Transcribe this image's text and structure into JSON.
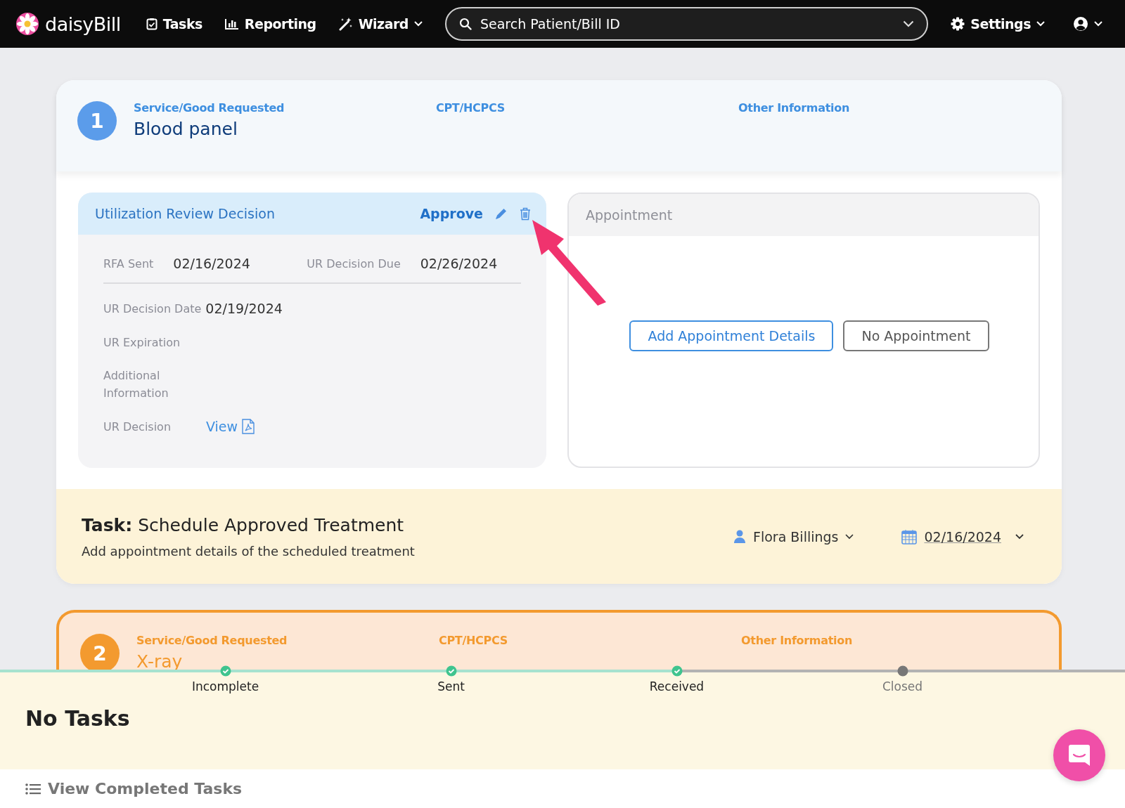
{
  "navbar": {
    "brand": "daisyBill",
    "items": [
      {
        "label": "Tasks",
        "dropdown": false
      },
      {
        "label": "Reporting",
        "dropdown": false
      },
      {
        "label": "Wizard",
        "dropdown": true
      }
    ],
    "search": {
      "placeholder": "Search Patient/Bill ID"
    },
    "settings": "Settings"
  },
  "requests": [
    {
      "number": "1",
      "service_label": "Service/Good Requested",
      "service": "Blood panel",
      "cpt_label": "CPT/HCPCS",
      "other_label": "Other Information",
      "highlighted": false
    },
    {
      "number": "2",
      "service_label": "Service/Good Requested",
      "service": "X-ray",
      "cpt_label": "CPT/HCPCS",
      "other_label": "Other Information",
      "highlighted": true
    }
  ],
  "ur_decision": {
    "title": "Utilization Review Decision",
    "decision": "Approve",
    "rfa_sent_label": "RFA Sent",
    "rfa_sent": "02/16/2024",
    "due_label": "UR Decision Due",
    "due": "02/26/2024",
    "date_label": "UR Decision Date",
    "date": "02/19/2024",
    "expiration_label": "UR Expiration",
    "additional_label": "Additional Information",
    "decision_doc_label": "UR Decision",
    "view_link": "View"
  },
  "appointment": {
    "title": "Appointment",
    "buttons": [
      {
        "label": "Add Appointment Details",
        "kind": "primary"
      },
      {
        "label": "No Appointment",
        "kind": "secondary"
      }
    ]
  },
  "task": {
    "prefix": "Task:",
    "title": "Schedule Approved Treatment",
    "description": "Add appointment details of the scheduled treatment",
    "assignee": "Flora Billings",
    "due": "02/16/2024"
  },
  "stepper": [
    {
      "label": "Incomplete",
      "done": true
    },
    {
      "label": "Sent",
      "done": true
    },
    {
      "label": "Received",
      "done": true
    },
    {
      "label": "Closed",
      "done": false
    }
  ],
  "tasks_panel": {
    "title": "No Tasks",
    "footer_link": "View Completed Tasks"
  }
}
